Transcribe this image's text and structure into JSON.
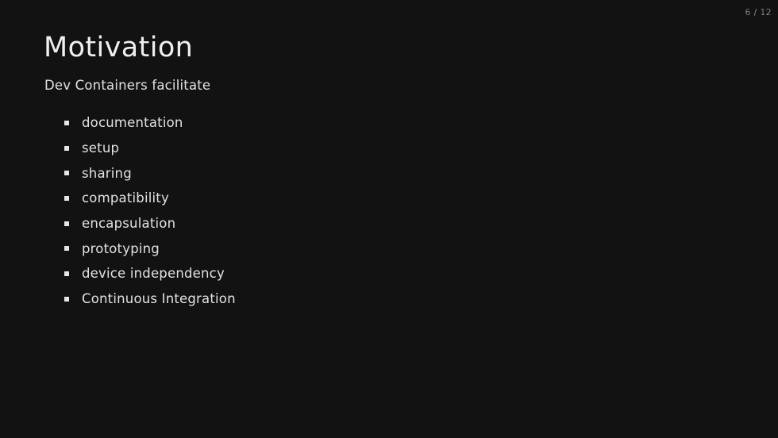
{
  "slide": {
    "counter": "6 / 12",
    "title": "Motivation",
    "intro": "Dev Containers facilitate",
    "bullet_icon": "square-bullet-icon",
    "items": [
      {
        "label": "documentation"
      },
      {
        "label": "setup"
      },
      {
        "label": "sharing"
      },
      {
        "label": "compatibility"
      },
      {
        "label": "encapsulation"
      },
      {
        "label": "prototyping"
      },
      {
        "label": "device independency"
      },
      {
        "label": "Continuous Integration"
      }
    ]
  },
  "colors": {
    "background": "#121212",
    "text": "#e2e2e2"
  }
}
